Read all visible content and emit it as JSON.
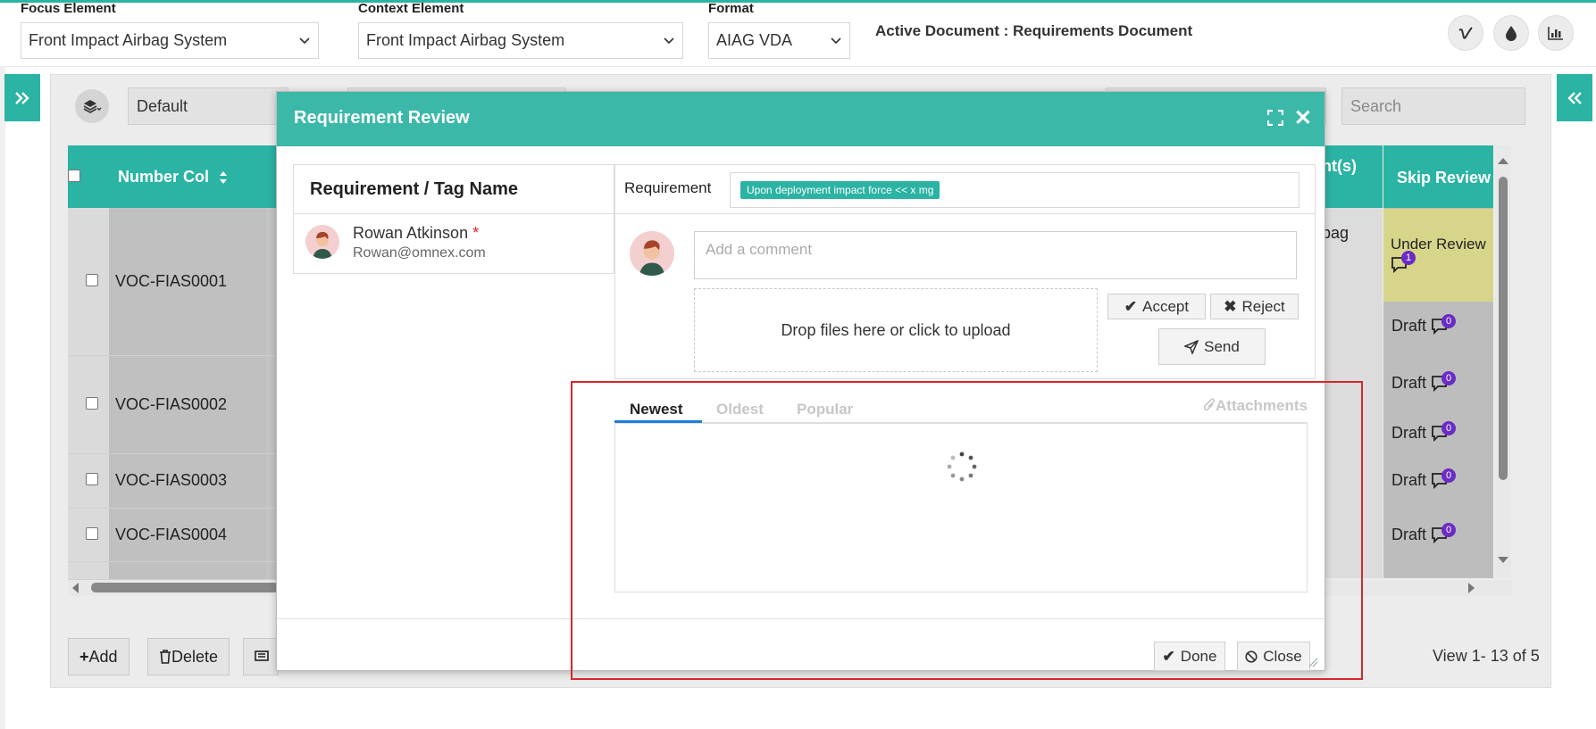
{
  "header": {
    "focus_label": "Focus Element",
    "focus_value": "Front Impact Airbag System",
    "context_label": "Context Element",
    "context_value": "Front Impact Airbag System",
    "format_label": "Format",
    "format_value": "AIAG VDA",
    "active_document": "Active Document : Requirements Document"
  },
  "toolbar": {
    "view_select": "Default",
    "search_placeholder": "Search"
  },
  "grid": {
    "columns": {
      "number": "Number Col",
      "ent_partial": "nt(s)",
      "skip_review": "Skip Review"
    },
    "rows": [
      {
        "number": "VOC-FIAS0001",
        "ent": "bag",
        "status": "Under Review",
        "count": "1"
      },
      {
        "number": "VOC-FIAS0002",
        "status": "Draft",
        "count": "0"
      },
      {
        "number": "VOC-FIAS0003",
        "status": "Draft",
        "count": "0"
      },
      {
        "number": "VOC-FIAS0004",
        "status": "Draft",
        "count": "0"
      }
    ],
    "extra_status": [
      {
        "status": "Draft",
        "count": "0"
      },
      {
        "status": "Draft",
        "count": "0"
      }
    ]
  },
  "footer": {
    "add": "Add",
    "delete": "Delete",
    "view_count": "View 1- 13 of 5"
  },
  "modal": {
    "title": "Requirement Review",
    "req_tag_header": "Requirement / Tag Name",
    "reviewer_name": "Rowan Atkinson",
    "required_mark": "*",
    "reviewer_email": "Rowan@omnex.com",
    "requirement_label": "Requirement",
    "requirement_tag": "Upon deployment impact force << x mg",
    "comment_placeholder": "Add a comment",
    "dropzone_text": "Drop files here or click to upload",
    "accept": "Accept",
    "reject": "Reject",
    "send": "Send",
    "tabs": {
      "newest": "Newest",
      "oldest": "Oldest",
      "popular": "Popular",
      "attachments": "Attachments"
    },
    "done": "Done",
    "close": "Close"
  },
  "colors": {
    "accent": "#2bb3a3",
    "highlight": "#d9262c",
    "badge": "#6a2cc4",
    "under_review": "#d7d58a"
  }
}
